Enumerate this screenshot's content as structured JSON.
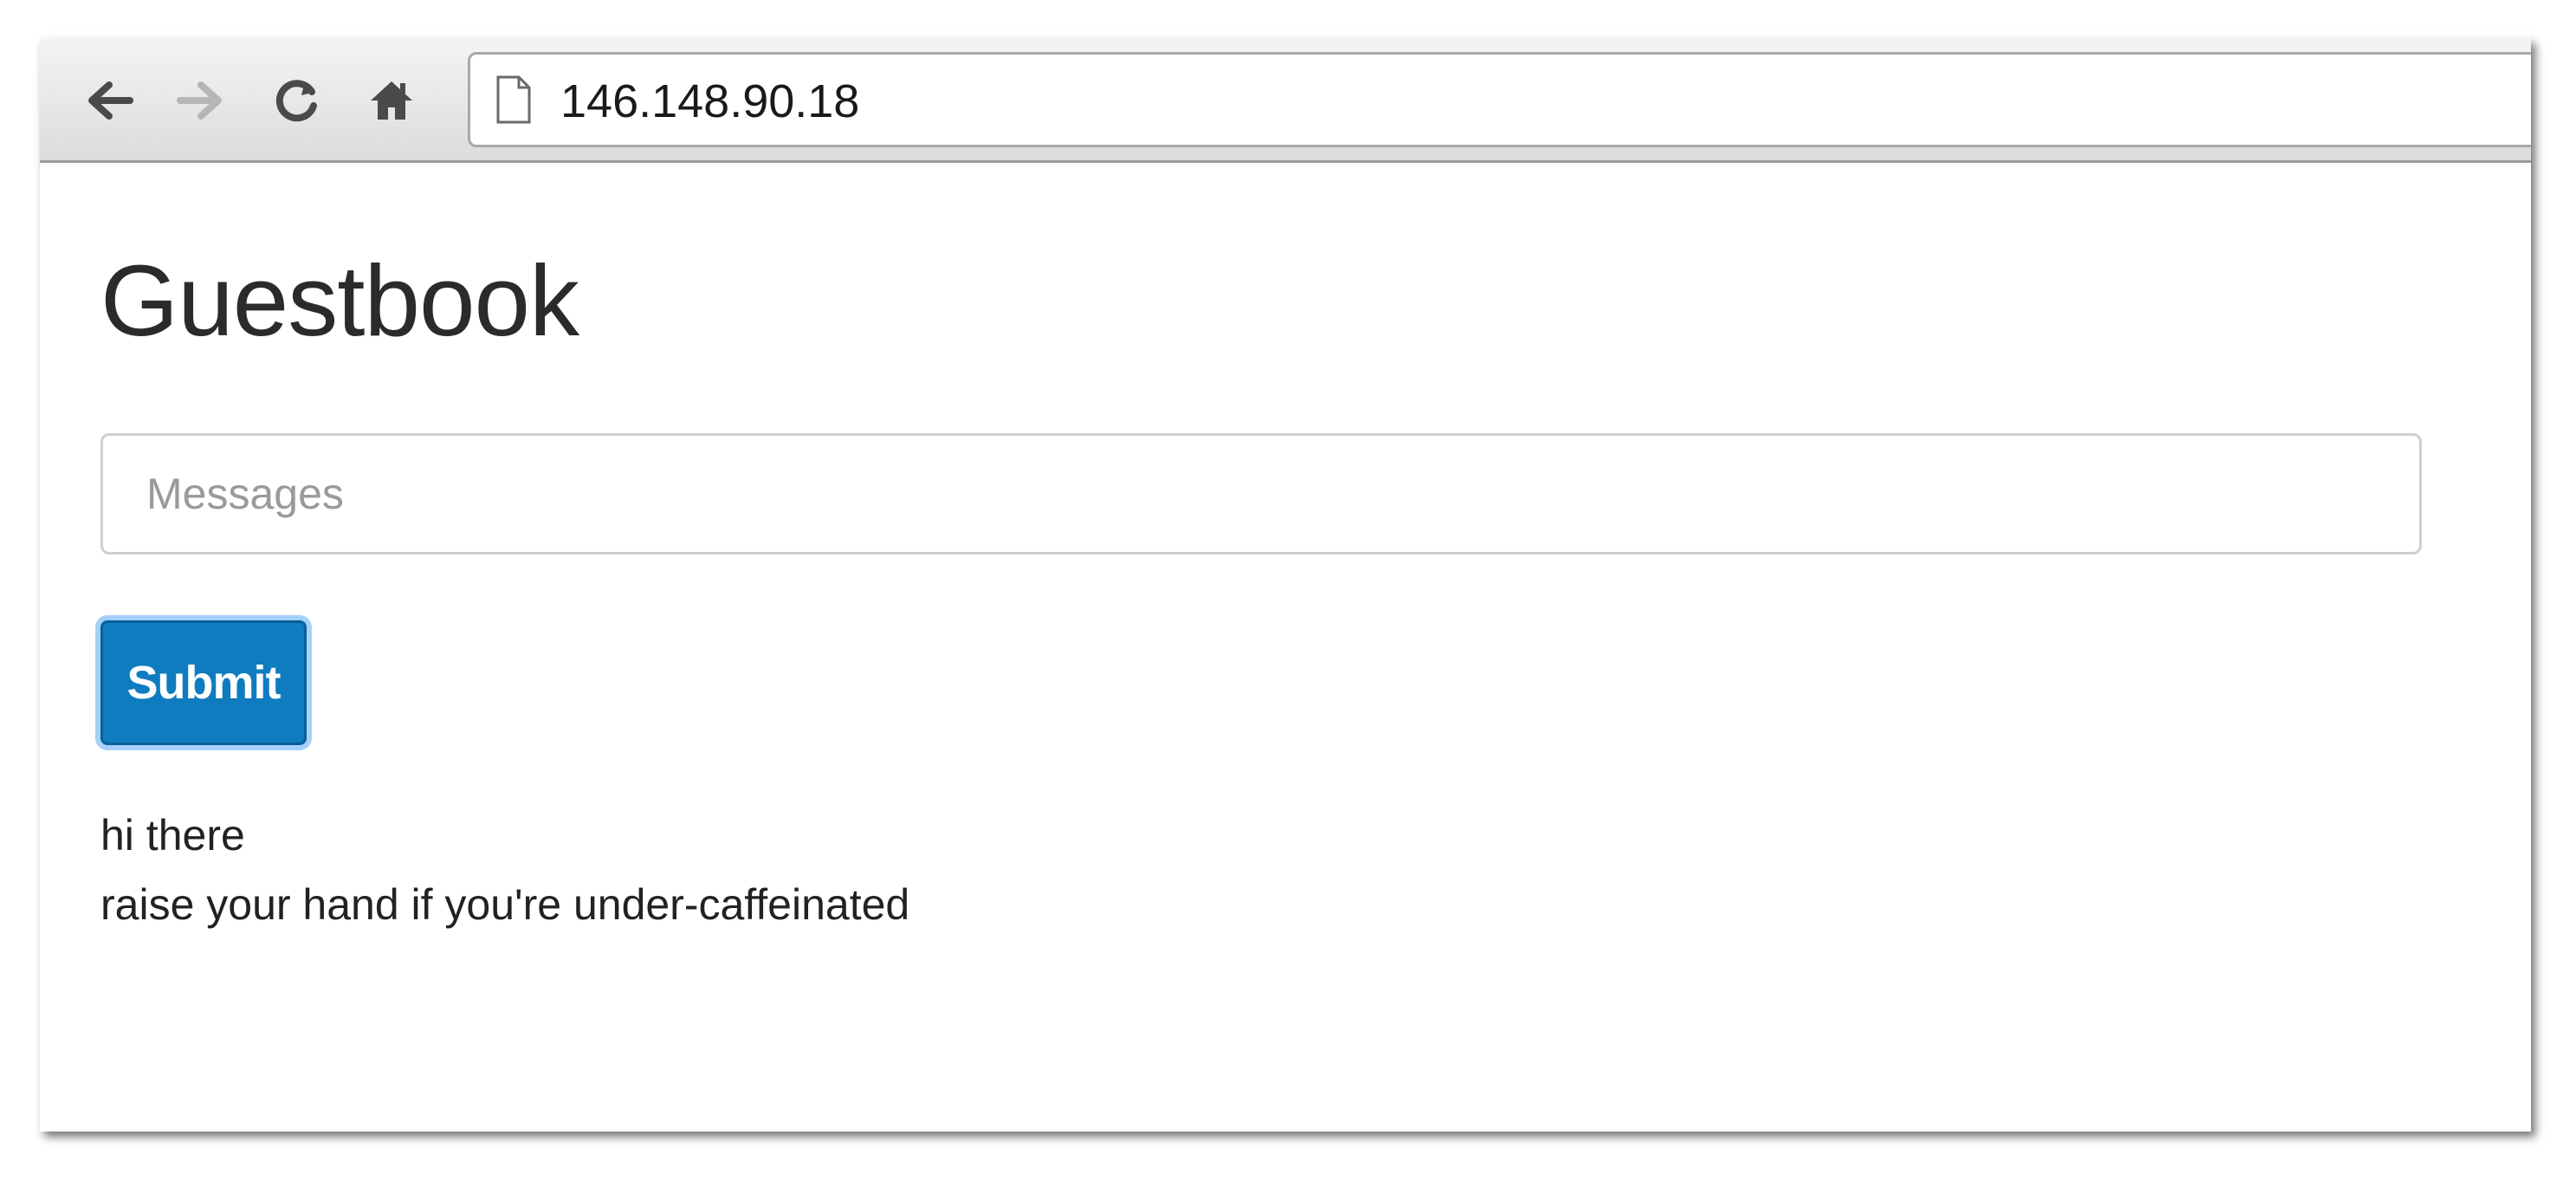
{
  "browser": {
    "url": "146.148.90.18",
    "nav": {
      "back_icon": "back-arrow-icon",
      "forward_icon": "forward-arrow-icon",
      "reload_icon": "reload-icon",
      "home_icon": "home-icon",
      "page_icon": "page-icon"
    }
  },
  "page": {
    "title": "Guestbook",
    "input": {
      "placeholder": "Messages",
      "value": ""
    },
    "submit_label": "Submit",
    "messages": [
      "hi there",
      "raise your hand if you're under-caffeinated"
    ]
  },
  "colors": {
    "button_primary": "#0f7cc0",
    "text": "#222222",
    "toolbar_bg": "#e6e6e6"
  }
}
